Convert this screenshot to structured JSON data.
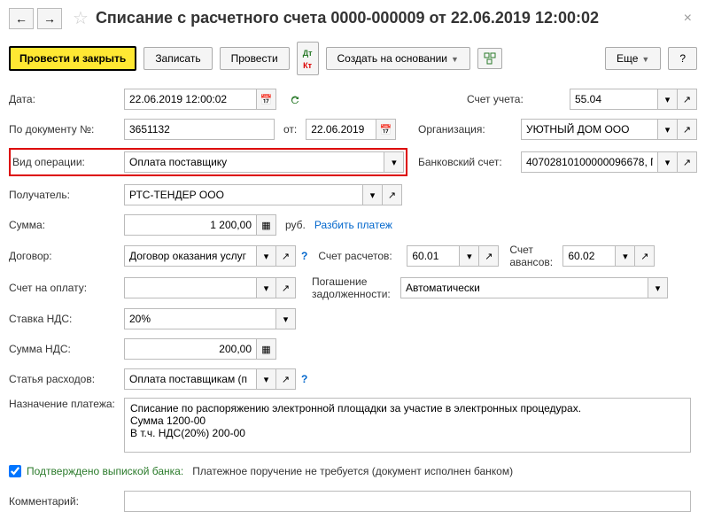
{
  "header": {
    "title": "Списание с расчетного счета 0000-000009 от 22.06.2019 12:00:02"
  },
  "toolbar": {
    "post_close": "Провести и закрыть",
    "save": "Записать",
    "post": "Провести",
    "create_based": "Создать на основании",
    "more": "Еще"
  },
  "labels": {
    "date": "Дата:",
    "doc_num": "По документу №:",
    "from": "от:",
    "op_type": "Вид операции:",
    "recipient": "Получатель:",
    "amount": "Сумма:",
    "rub": "руб.",
    "split": "Разбить платеж",
    "contract": "Договор:",
    "settle_acc": "Счет расчетов:",
    "advance_acc": "Счет авансов:",
    "invoice": "Счет на оплату:",
    "debt": "Погашение задолженности:",
    "vat_rate": "Ставка НДС:",
    "vat_amount": "Сумма НДС:",
    "expense": "Статья расходов:",
    "purpose": "Назначение платежа:",
    "account": "Счет учета:",
    "org": "Организация:",
    "bank_acc": "Банковский счет:",
    "confirmed": "Подтверждено выпиской банка:",
    "payment_order": "Платежное поручение не требуется (документ исполнен банком)",
    "comment": "Комментарий:"
  },
  "values": {
    "date": "22.06.2019 12:00:02",
    "doc_num": "3651132",
    "doc_date": "22.06.2019",
    "op_type": "Оплата поставщику",
    "recipient": "РТС-ТЕНДЕР ООО",
    "amount": "1 200,00",
    "contract": "Договор оказания услуг",
    "settle_acc": "60.01",
    "advance_acc": "60.02",
    "debt": "Автоматически",
    "vat_rate": "20%",
    "vat_amount": "200,00",
    "expense": "Оплата поставщикам (п",
    "purpose": "Списание по распоряжению электронной площадки за участие в электронных процедурах.\nСумма 1200-00\nВ т.ч. НДС(20%) 200-00",
    "account": "55.04",
    "org": "УЮТНЫЙ ДОМ ООО",
    "bank_acc": "40702810100000096678, П"
  }
}
